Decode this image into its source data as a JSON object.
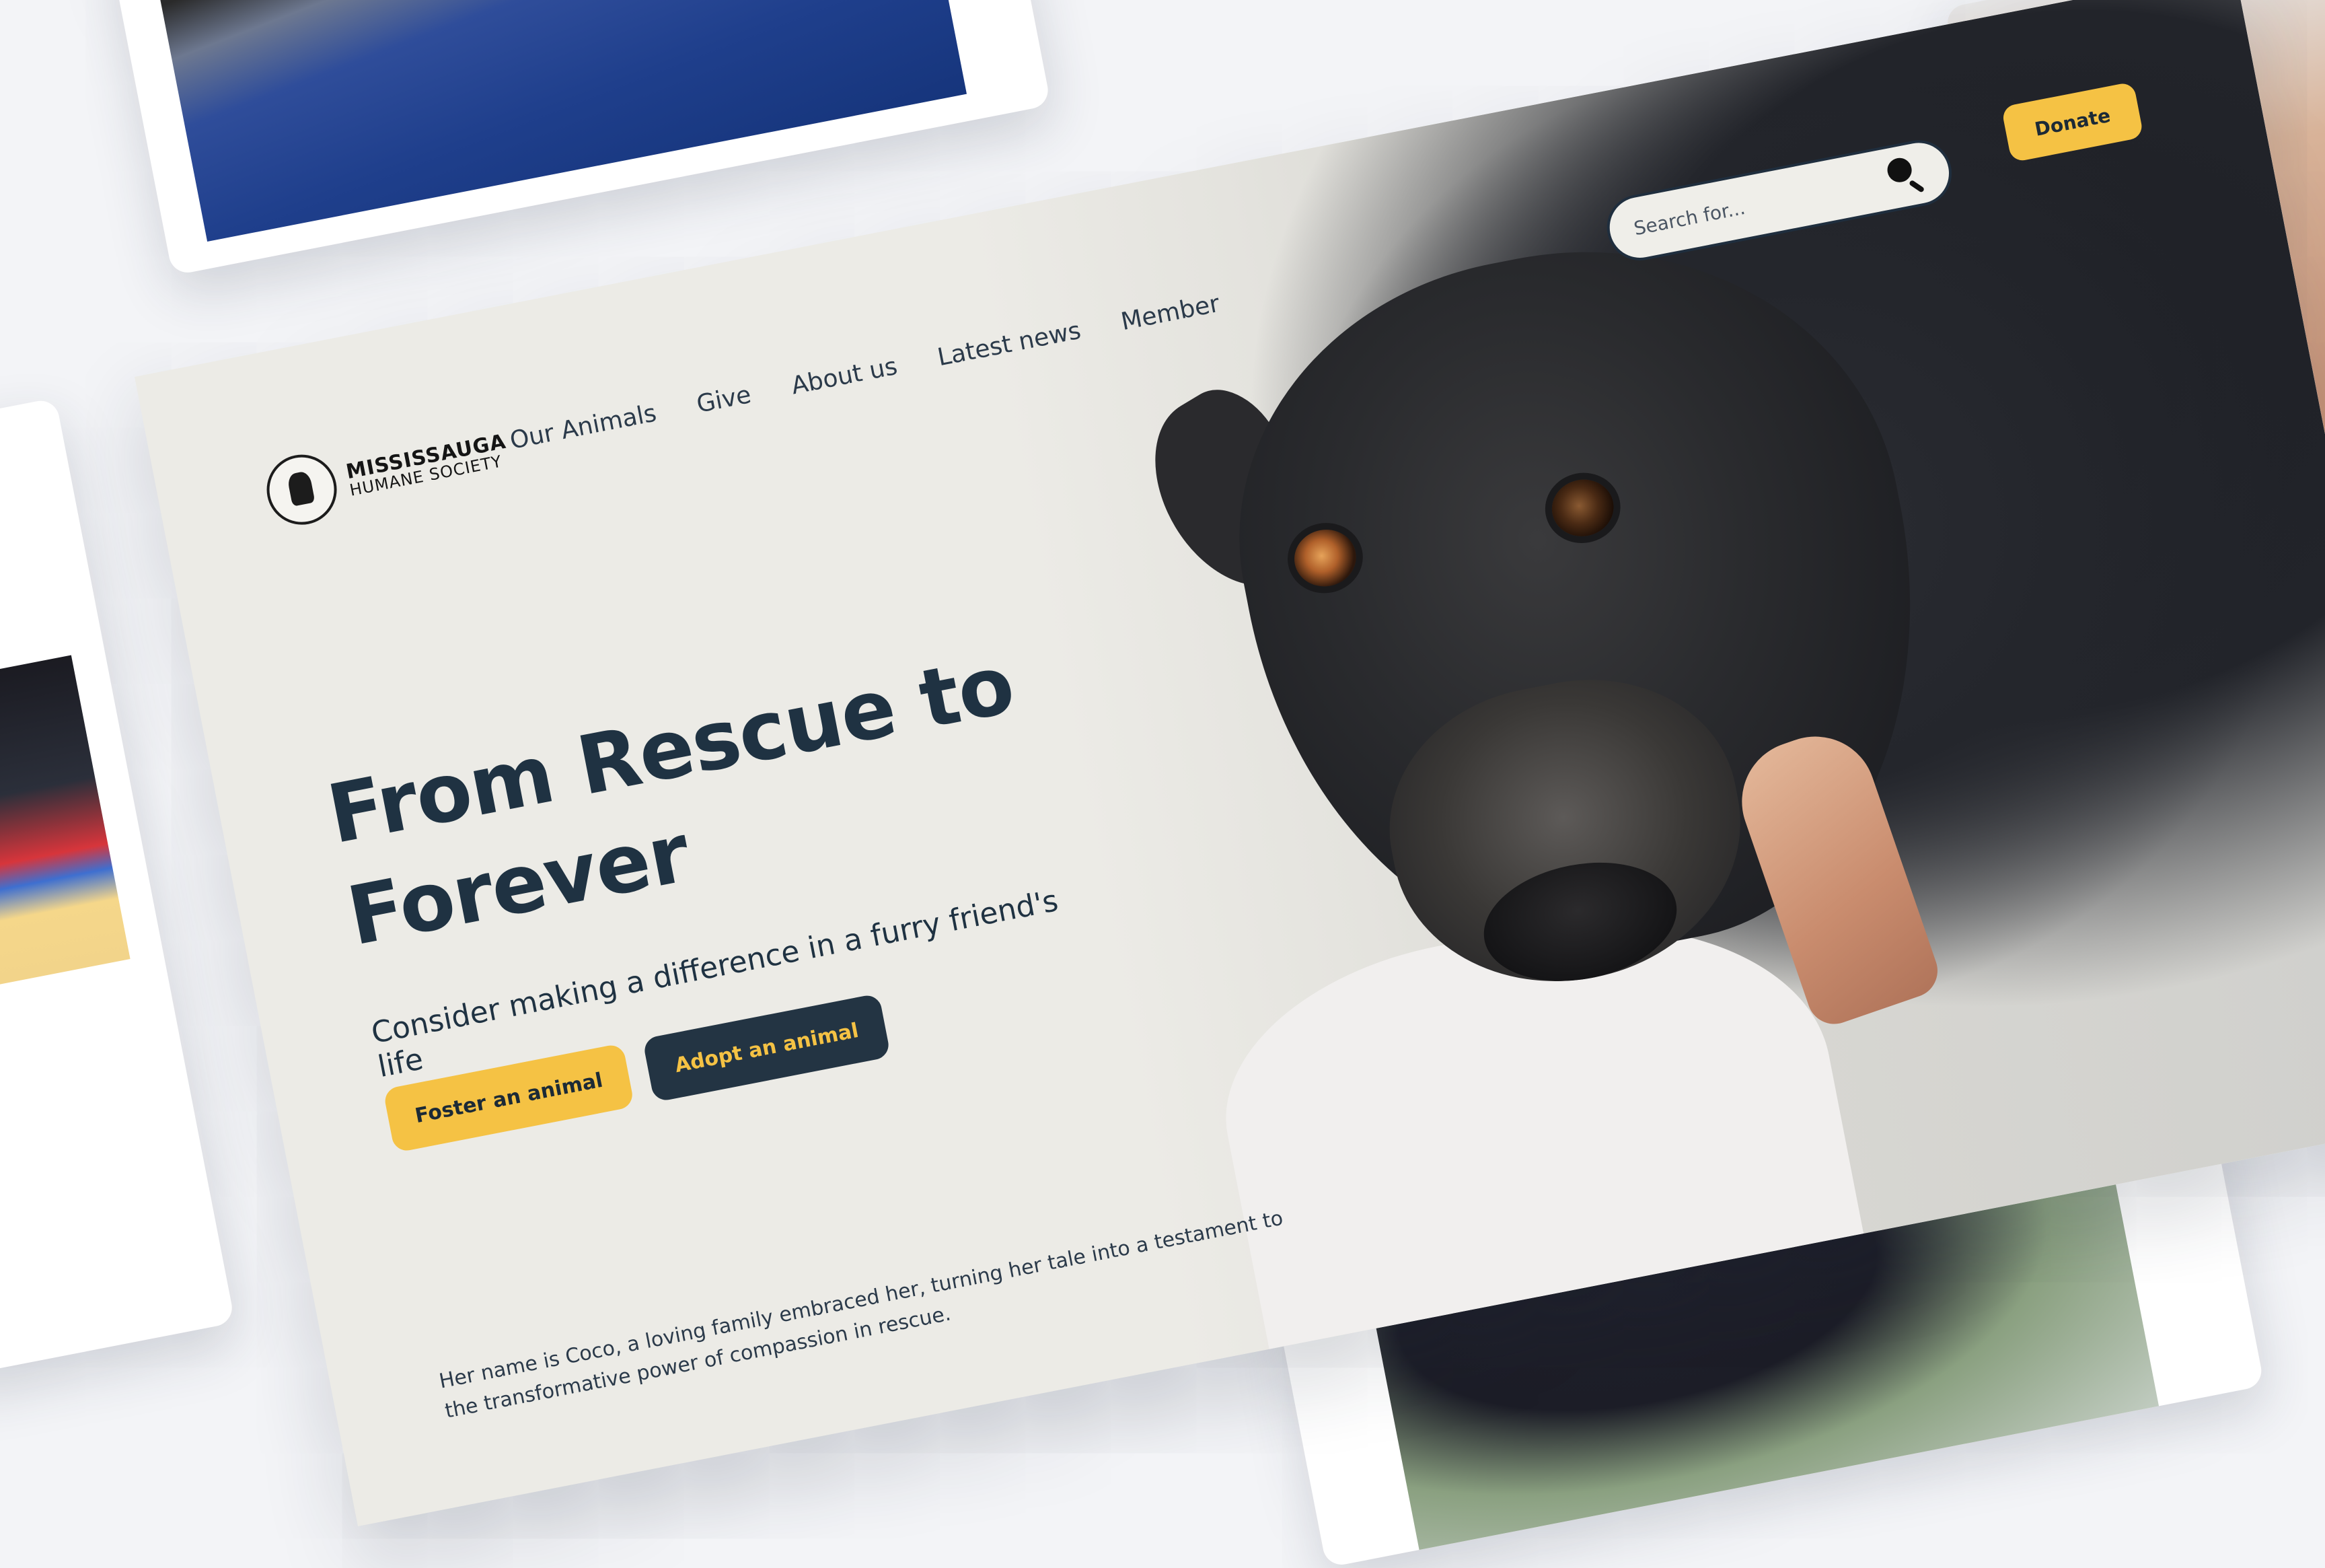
{
  "site": {
    "logo": {
      "line1": "MISSISSAUGA",
      "line2": "HUMANE SOCIETY",
      "icon": "humane-society-emblem"
    },
    "nav": [
      {
        "label": "Our Animals"
      },
      {
        "label": "Give"
      },
      {
        "label": "About us"
      },
      {
        "label": "Latest news"
      },
      {
        "label": "Member"
      }
    ],
    "search": {
      "placeholder": "Search for...",
      "icon": "search-icon"
    },
    "donate_label": "Donate"
  },
  "hero": {
    "title": "From Rescue to Forever",
    "subtitle": "Consider making a difference in a furry friend's life",
    "buttons": {
      "foster": "Foster an animal",
      "adopt": "Adopt an animal"
    },
    "story": "Her name is Coco, a loving family embraced her, turning her tale into a testament to the transformative power of compassion in rescue."
  },
  "colors": {
    "accent_yellow": "#f5c244",
    "navy": "#233443",
    "text": "#1f3242",
    "background": "#ecebe6"
  }
}
